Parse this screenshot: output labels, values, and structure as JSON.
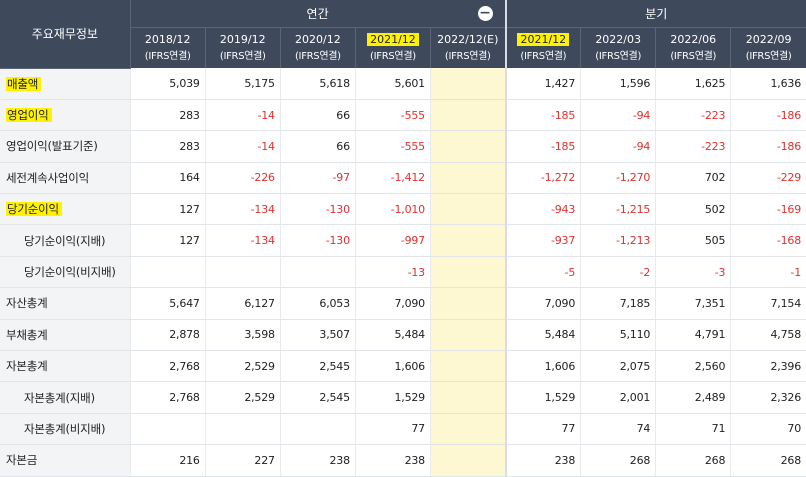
{
  "header": {
    "corner": "주요재무정보",
    "annual_group": "연간",
    "quarter_group": "분기",
    "collapse_icon": "minus-circle-icon",
    "annual_cols": [
      {
        "period": "2018/12",
        "basis": "(IFRS연결)",
        "hl": false
      },
      {
        "period": "2019/12",
        "basis": "(IFRS연결)",
        "hl": false
      },
      {
        "period": "2020/12",
        "basis": "(IFRS연결)",
        "hl": false
      },
      {
        "period": "2021/12",
        "basis": "(IFRS연결)",
        "hl": true
      },
      {
        "period": "2022/12(E)",
        "basis": "(IFRS연결)",
        "hl": false
      }
    ],
    "quarter_cols": [
      {
        "period": "2021/12",
        "basis": "(IFRS연결)",
        "hl": true
      },
      {
        "period": "2022/03",
        "basis": "(IFRS연결)",
        "hl": false
      },
      {
        "period": "2022/06",
        "basis": "(IFRS연결)",
        "hl": false
      },
      {
        "period": "2022/09",
        "basis": "(IFRS연결)",
        "hl": false
      }
    ]
  },
  "rows": [
    {
      "label": "매출액",
      "mark": true,
      "indent": false,
      "values": [
        "5,039",
        "5,175",
        "5,618",
        "5,601",
        "",
        "1,427",
        "1,596",
        "1,625",
        "1,636"
      ]
    },
    {
      "label": "영업이익",
      "mark": true,
      "indent": false,
      "values": [
        "283",
        "-14",
        "66",
        "-555",
        "",
        "-185",
        "-94",
        "-223",
        "-186"
      ]
    },
    {
      "label": "영업이익(발표기준)",
      "mark": false,
      "indent": false,
      "values": [
        "283",
        "-14",
        "66",
        "-555",
        "",
        "-185",
        "-94",
        "-223",
        "-186"
      ]
    },
    {
      "label": "세전계속사업이익",
      "mark": false,
      "indent": false,
      "values": [
        "164",
        "-226",
        "-97",
        "-1,412",
        "",
        "-1,272",
        "-1,270",
        "702",
        "-229"
      ]
    },
    {
      "label": "당기순이익",
      "mark": true,
      "indent": false,
      "values": [
        "127",
        "-134",
        "-130",
        "-1,010",
        "",
        "-943",
        "-1,215",
        "502",
        "-169"
      ]
    },
    {
      "label": "당기순이익(지배)",
      "mark": false,
      "indent": true,
      "values": [
        "127",
        "-134",
        "-130",
        "-997",
        "",
        "-937",
        "-1,213",
        "505",
        "-168"
      ]
    },
    {
      "label": "당기순이익(비지배)",
      "mark": false,
      "indent": true,
      "values": [
        "",
        "",
        "",
        "-13",
        "",
        "-5",
        "-2",
        "-3",
        "-1"
      ]
    },
    {
      "label": "자산총계",
      "mark": false,
      "indent": false,
      "values": [
        "5,647",
        "6,127",
        "6,053",
        "7,090",
        "",
        "7,090",
        "7,185",
        "7,351",
        "7,154"
      ]
    },
    {
      "label": "부채총계",
      "mark": false,
      "indent": false,
      "values": [
        "2,878",
        "3,598",
        "3,507",
        "5,484",
        "",
        "5,484",
        "5,110",
        "4,791",
        "4,758"
      ]
    },
    {
      "label": "자본총계",
      "mark": false,
      "indent": false,
      "values": [
        "2,768",
        "2,529",
        "2,545",
        "1,606",
        "",
        "1,606",
        "2,075",
        "2,560",
        "2,396"
      ]
    },
    {
      "label": "자본총계(지배)",
      "mark": false,
      "indent": true,
      "values": [
        "2,768",
        "2,529",
        "2,545",
        "1,529",
        "",
        "1,529",
        "2,001",
        "2,489",
        "2,326"
      ]
    },
    {
      "label": "자본총계(비지배)",
      "mark": false,
      "indent": true,
      "values": [
        "",
        "",
        "",
        "77",
        "",
        "77",
        "74",
        "71",
        "70"
      ]
    },
    {
      "label": "자본금",
      "mark": false,
      "indent": false,
      "values": [
        "216",
        "227",
        "238",
        "238",
        "",
        "238",
        "268",
        "268",
        "268"
      ]
    }
  ],
  "colors": {
    "header_bg": "#3e4a5c",
    "negative": "#e0302e",
    "highlight": "#fff200",
    "estimate_bg": "#fdf7d2"
  }
}
